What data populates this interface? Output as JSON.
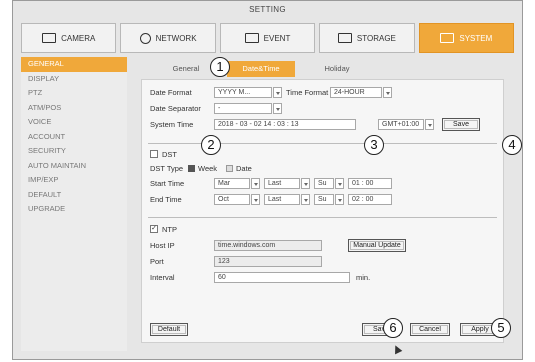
{
  "window": {
    "title": "SETTING"
  },
  "top_tabs": [
    {
      "label": "CAMERA",
      "icon": "camera-icon"
    },
    {
      "label": "NETWORK",
      "icon": "network-icon"
    },
    {
      "label": "EVENT",
      "icon": "event-icon"
    },
    {
      "label": "STORAGE",
      "icon": "storage-icon"
    },
    {
      "label": "SYSTEM",
      "icon": "system-icon",
      "active": true
    }
  ],
  "sidebar": {
    "items": [
      "GENERAL",
      "DISPLAY",
      "PTZ",
      "ATM/POS",
      "VOICE",
      "ACCOUNT",
      "SECURITY",
      "AUTO MAINTAIN",
      "IMP/EXP",
      "DEFAULT",
      "UPGRADE"
    ],
    "active": "GENERAL"
  },
  "sub_tabs": [
    "General",
    "Date&Time",
    "Holiday"
  ],
  "form": {
    "date_format_label": "Date Format",
    "date_format_value": "YYYY M...",
    "time_format_label": "Time Format",
    "time_format_value": "24-HOUR",
    "date_separator_label": "Date Separator",
    "date_separator_value": "-",
    "system_time_label": "System Time",
    "system_time_value": "2018 - 03 - 02  14 : 03 : 13",
    "gmt_value": "GMT+01:00",
    "save_time_label": "Save"
  },
  "dst": {
    "label": "DST",
    "checked": false,
    "type_label": "DST Type",
    "type_week": "Week",
    "type_date": "Date",
    "start_label": "Start Time",
    "start": {
      "month": "Mar",
      "week": "Last",
      "day": "Su",
      "time": "01 : 00"
    },
    "end_label": "End Time",
    "end": {
      "month": "Oct",
      "week": "Last",
      "day": "Su",
      "time": "02 : 00"
    }
  },
  "ntp": {
    "label": "NTP",
    "checked": true,
    "check_mark": "✓",
    "host_label": "Host IP",
    "host_value": "time.windows.com",
    "manual_update_label": "Manual Update",
    "port_label": "Port",
    "port_value": "123",
    "interval_label": "Interval",
    "interval_value": "60",
    "interval_unit": "min."
  },
  "footer": {
    "default_label": "Default",
    "save_label": "Save",
    "cancel_label": "Cancel",
    "apply_label": "Apply"
  },
  "markers": [
    "1",
    "2",
    "3",
    "4",
    "5",
    "6"
  ],
  "colors": {
    "accent": "#f0a83a"
  }
}
